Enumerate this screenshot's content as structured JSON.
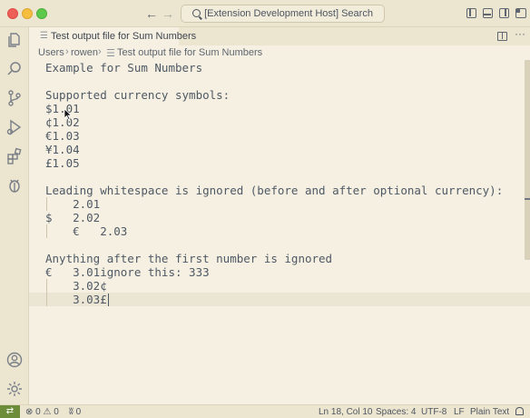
{
  "window": {
    "command_center": "[Extension Development Host] Search"
  },
  "tabs": [
    {
      "label": "Test output file for Sum Numbers"
    }
  ],
  "breadcrumb": [
    "Users",
    "rowen",
    "Test output file for Sum Numbers"
  ],
  "editor": {
    "lines": [
      "Example for Sum Numbers",
      "",
      "Supported currency symbols:",
      "$1.01",
      "¢1.02",
      "€1.03",
      "¥1.04",
      "£1.05",
      "",
      "Leading whitespace is ignored (before and after optional currency):",
      "    2.01",
      "$   2.02",
      "    €   2.03",
      "",
      "Anything after the first number is ignored",
      "€   3.01ignore this: 333",
      "    3.02¢",
      "    3.03£"
    ],
    "current_line": 18
  },
  "status": {
    "errors": "0",
    "warnings": "0",
    "ports": "0",
    "position": "Ln 18, Col 10",
    "spaces": "Spaces: 4",
    "encoding": "UTF-8",
    "eol": "LF",
    "language": "Plain Text"
  },
  "colors": {
    "background": "#f5f0e1",
    "chrome": "#ece5d0",
    "remote_accent": "#6d8d3a"
  }
}
